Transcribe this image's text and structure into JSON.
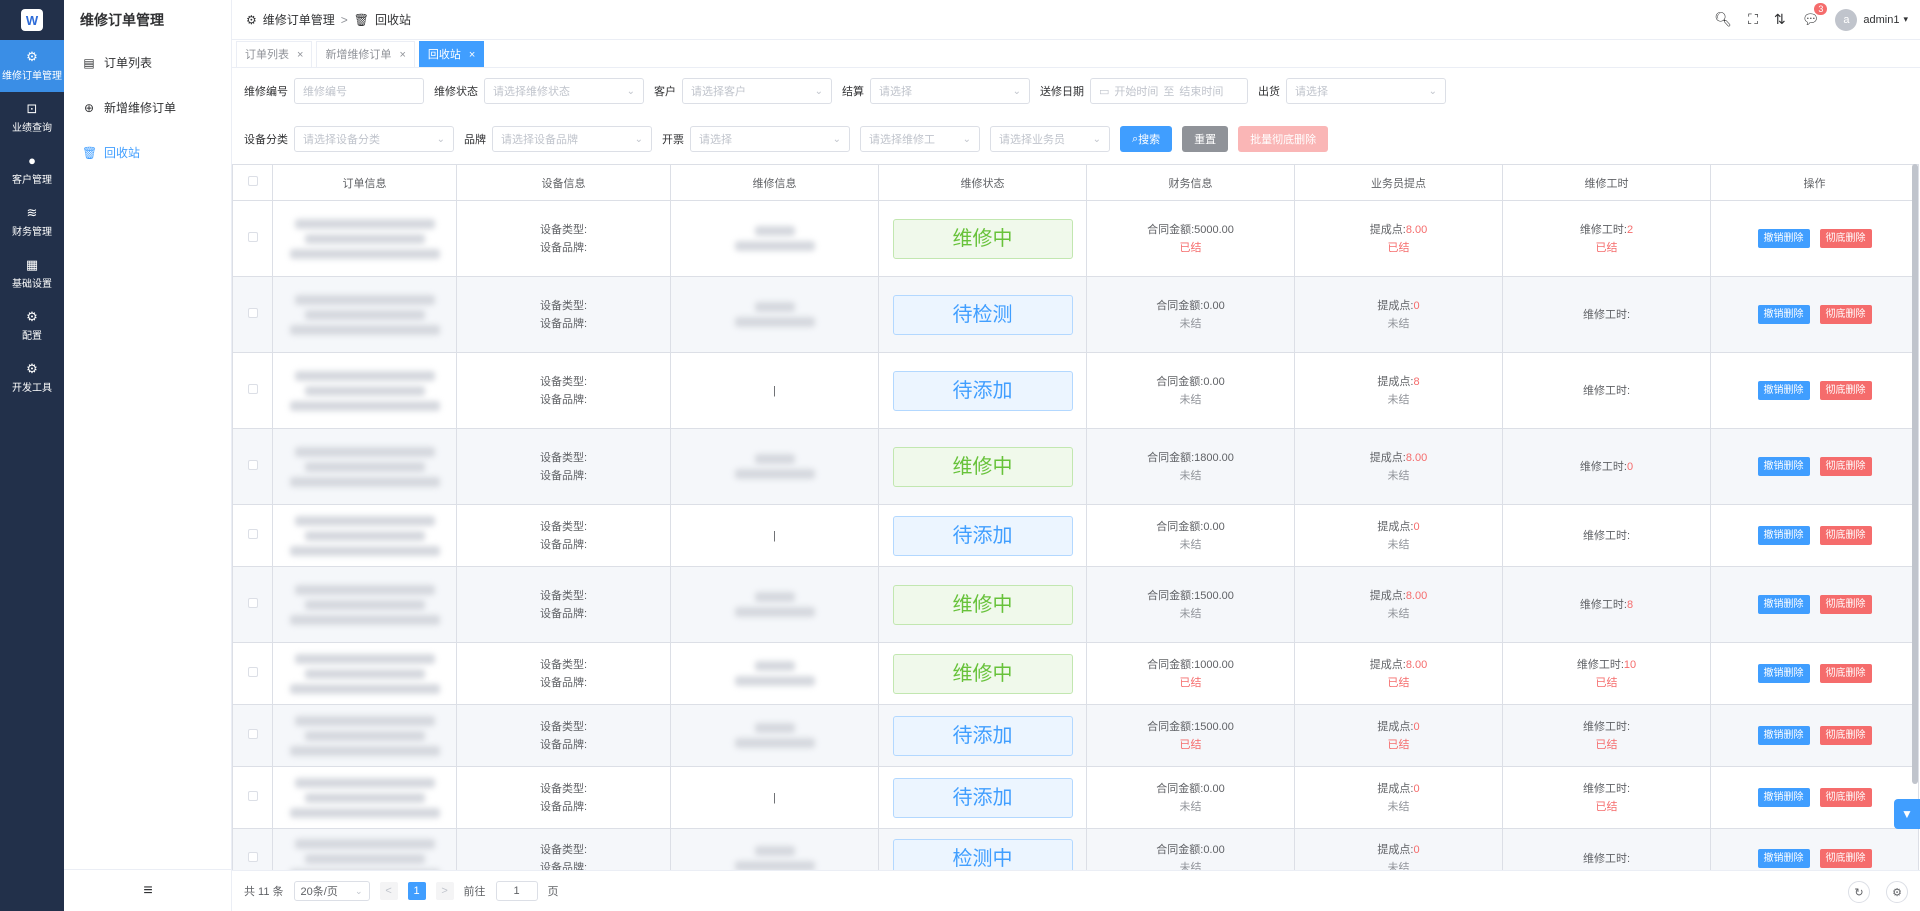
{
  "logo": {
    "text": "W"
  },
  "rail": [
    {
      "icon": "gear-icon",
      "glyph": "⚙",
      "label": "维修订单管理",
      "active": true
    },
    {
      "icon": "chart-icon",
      "glyph": "⊡",
      "label": "业绩查询",
      "active": false
    },
    {
      "icon": "user-icon",
      "glyph": "●",
      "label": "客户管理",
      "active": false
    },
    {
      "icon": "database-icon",
      "glyph": "≋",
      "label": "财务管理",
      "active": false
    },
    {
      "icon": "grid-icon",
      "glyph": "▦",
      "label": "基础设置",
      "active": false
    },
    {
      "icon": "settings-icon",
      "glyph": "⚙",
      "label": "配置",
      "active": false
    },
    {
      "icon": "tool-icon",
      "glyph": "⚙",
      "label": "开发工具",
      "active": false
    }
  ],
  "submenu": {
    "title": "维修订单管理",
    "items": [
      {
        "icon": "list-icon",
        "glyph": "▤",
        "label": "订单列表",
        "active": false
      },
      {
        "icon": "plus-circle-icon",
        "glyph": "⊕",
        "label": "新增维修订单",
        "active": false
      },
      {
        "icon": "trash-icon",
        "glyph": "🗑",
        "label": "回收站",
        "active": true
      }
    ],
    "footer_glyph": "≡"
  },
  "breadcrumb": {
    "root": "维修订单管理",
    "separator": ">",
    "current": "回收站"
  },
  "topbar": {
    "notification_count": "3",
    "username": "admin1",
    "avatar_letter": "a"
  },
  "tabs": [
    {
      "label": "订单列表",
      "active": false
    },
    {
      "label": "新增维修订单",
      "active": false
    },
    {
      "label": "回收站",
      "active": true
    }
  ],
  "filters": {
    "row1": [
      {
        "label": "维修编号",
        "placeholder": "维修编号",
        "dropdown": false
      },
      {
        "label": "维修状态",
        "placeholder": "请选择维修状态",
        "dropdown": true
      },
      {
        "label": "客户",
        "placeholder": "请选择客户",
        "dropdown": true
      },
      {
        "label": "结算",
        "placeholder": "请选择",
        "dropdown": true
      }
    ],
    "date_label": "送修日期",
    "date_start": "开始时间",
    "date_sep": "至",
    "date_end": "结束时间",
    "ship_label": "出货",
    "ship_placeholder": "请选择",
    "row2": [
      {
        "label": "设备分类",
        "placeholder": "请选择设备分类",
        "dropdown": true
      },
      {
        "label": "品牌",
        "placeholder": "请选择设备品牌",
        "dropdown": true
      },
      {
        "label": "开票",
        "placeholder": "请选择",
        "dropdown": true
      },
      {
        "label": "",
        "placeholder": "请选择维修工",
        "dropdown": true
      },
      {
        "label": "",
        "placeholder": "请选择业务员",
        "dropdown": true
      }
    ],
    "search_btn": "搜索",
    "reset_btn": "重置",
    "batch_delete_btn": "批量彻底删除"
  },
  "table": {
    "headers": [
      "订单信息",
      "设备信息",
      "维修信息",
      "维修状态",
      "财务信息",
      "业务员提点",
      "维修工时",
      "操作"
    ],
    "device_type_label": "设备类型:",
    "device_brand_label": "设备品牌:",
    "contract_label": "合同金额:",
    "commission_label": "提成点:",
    "hours_label": "维修工时:",
    "undo_btn": "撤销删除",
    "delete_btn": "彻底删除",
    "rows": [
      {
        "status": "维修中",
        "status_color": "#67c23a",
        "amount": "5000.00",
        "fin_state": "已结",
        "fin_red": true,
        "comm": "8.00",
        "comm_state": "已结",
        "comm_red": true,
        "hours": "2",
        "hours_state": "已结",
        "repair_dash": false
      },
      {
        "status": "待检测",
        "status_color": "#409eff",
        "amount": "0.00",
        "fin_state": "未结",
        "fin_red": false,
        "comm": "0",
        "comm_state": "未结",
        "comm_red": false,
        "hours": "",
        "hours_state": "",
        "repair_dash": false
      },
      {
        "status": "待添加",
        "status_color": "#409eff",
        "amount": "0.00",
        "fin_state": "未结",
        "fin_red": false,
        "comm": "8",
        "comm_state": "未结",
        "comm_red": false,
        "hours": "",
        "hours_state": "",
        "repair_dash": true
      },
      {
        "status": "维修中",
        "status_color": "#67c23a",
        "amount": "1800.00",
        "fin_state": "未结",
        "fin_red": false,
        "comm": "8.00",
        "comm_state": "未结",
        "comm_red": false,
        "hours": "0",
        "hours_state": "",
        "repair_dash": false
      },
      {
        "status": "待添加",
        "status_color": "#409eff",
        "amount": "0.00",
        "fin_state": "未结",
        "fin_red": false,
        "comm": "0",
        "comm_state": "未结",
        "comm_red": false,
        "hours": "",
        "hours_state": "",
        "repair_dash": true
      },
      {
        "status": "维修中",
        "status_color": "#67c23a",
        "amount": "1500.00",
        "fin_state": "未结",
        "fin_red": false,
        "comm": "8.00",
        "comm_state": "未结",
        "comm_red": false,
        "hours": "8",
        "hours_state": "",
        "repair_dash": false
      },
      {
        "status": "维修中",
        "status_color": "#67c23a",
        "amount": "1000.00",
        "fin_state": "已结",
        "fin_red": true,
        "comm": "8.00",
        "comm_state": "已结",
        "comm_red": true,
        "hours": "10",
        "hours_state": "已结",
        "repair_dash": false
      },
      {
        "status": "待添加",
        "status_color": "#409eff",
        "amount": "1500.00",
        "fin_state": "已结",
        "fin_red": true,
        "comm": "0",
        "comm_state": "已结",
        "comm_red": true,
        "hours": "",
        "hours_state": "已结",
        "repair_dash": false
      },
      {
        "status": "待添加",
        "status_color": "#409eff",
        "amount": "0.00",
        "fin_state": "未结",
        "fin_red": false,
        "comm": "0",
        "comm_state": "未结",
        "comm_red": false,
        "hours": "",
        "hours_state": "已结",
        "repair_dash": true
      },
      {
        "status": "检测中",
        "status_color": "#409eff",
        "amount": "0.00",
        "fin_state": "未结",
        "fin_red": false,
        "comm": "0",
        "comm_state": "未结",
        "comm_red": false,
        "hours": "",
        "hours_state": "",
        "repair_dash": false
      }
    ]
  },
  "pagination": {
    "total": "共 11 条",
    "page_size": "20条/页",
    "prev": "<",
    "current_page": "1",
    "next": ">",
    "goto_label": "前往",
    "goto_value": "1",
    "page_unit": "页"
  },
  "colors": {
    "primary": "#409eff",
    "danger": "#f56c6c",
    "success": "#67c23a",
    "rail_bg": "#22304a"
  }
}
